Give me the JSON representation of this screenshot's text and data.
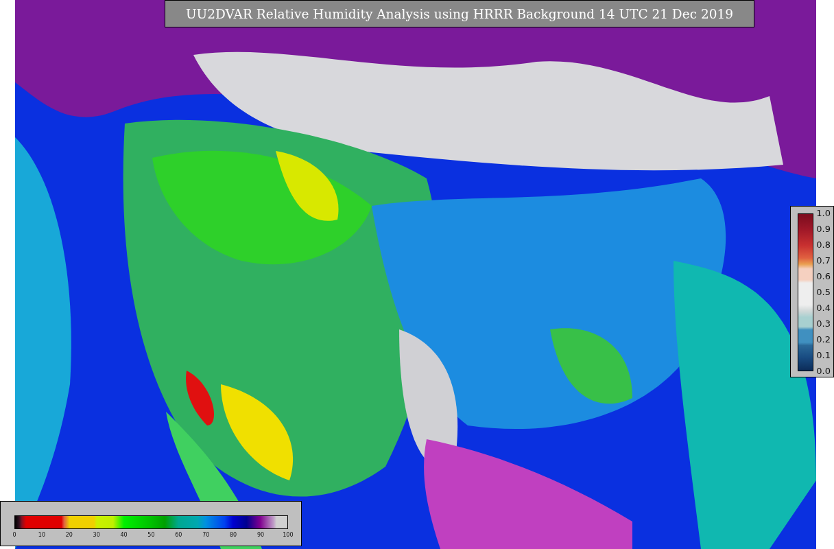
{
  "title": "UU2DVAR Relative Humidity Analysis using HRRR Background 14 UTC 21 Dec 2019",
  "humidity_colorbar": {
    "ticks": [
      "0",
      "10",
      "20",
      "30",
      "40",
      "50",
      "60",
      "70",
      "80",
      "90",
      "100"
    ]
  },
  "ratio_colorbar": {
    "ticks": [
      "1.0",
      "0.9",
      "0.8",
      "0.7",
      "0.6",
      "0.5",
      "0.4",
      "0.3",
      "0.2",
      "0.1",
      "0.0"
    ]
  }
}
